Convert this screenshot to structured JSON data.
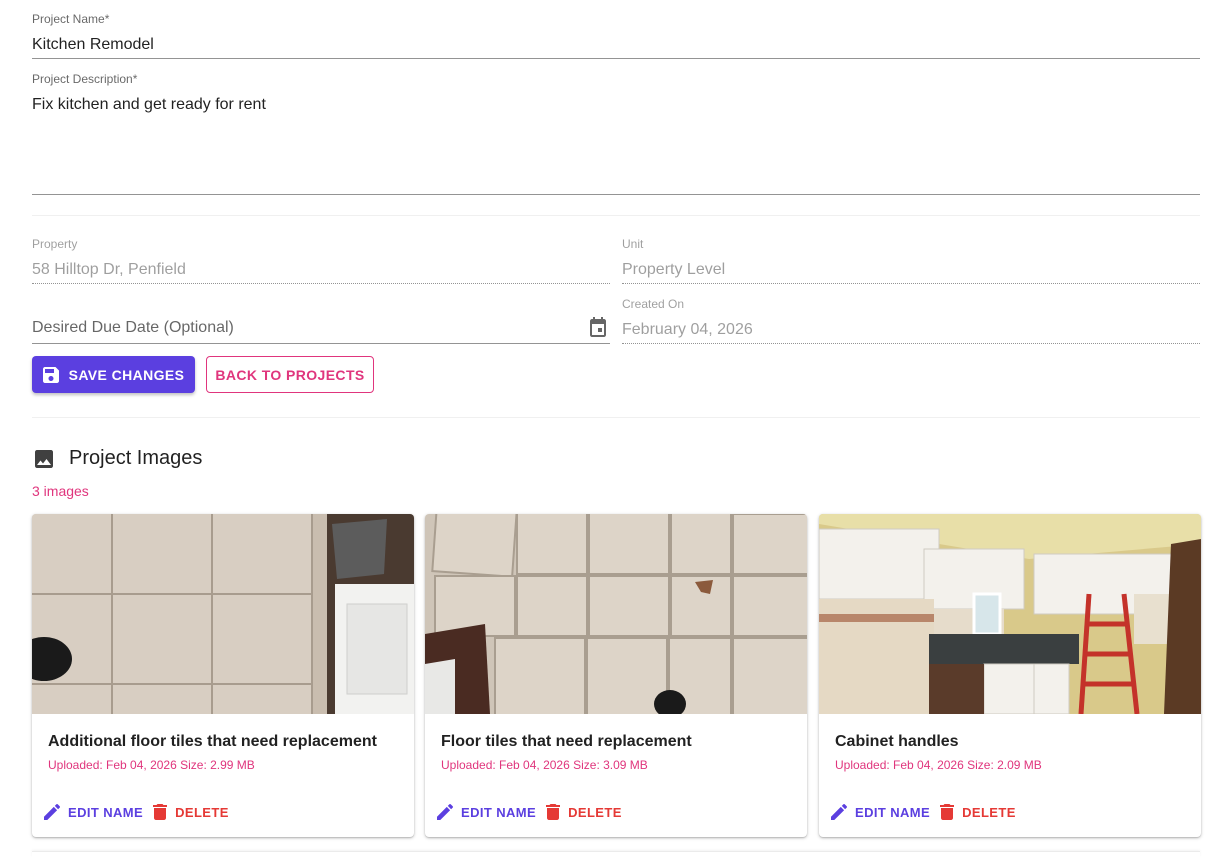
{
  "form": {
    "project_name": {
      "label": "Project Name*",
      "value": "Kitchen Remodel"
    },
    "project_description": {
      "label": "Project Description*",
      "value": "Fix kitchen and get ready for rent"
    },
    "property": {
      "label": "Property",
      "value": "58 Hilltop Dr, Penfield"
    },
    "unit": {
      "label": "Unit",
      "value": "Property Level"
    },
    "due_date": {
      "placeholder": "Desired Due Date (Optional)"
    },
    "created_on": {
      "label": "Created On",
      "value": "February 04, 2026"
    }
  },
  "actions": {
    "save_label": "SAVE CHANGES",
    "back_label": "BACK TO PROJECTS"
  },
  "images_section": {
    "title": "Project Images",
    "count": "3 images",
    "cards": [
      {
        "title": "Additional floor tiles that need replacement",
        "meta": "Uploaded: Feb 04, 2026 Size: 2.99 MB",
        "edit_label": "EDIT NAME",
        "delete_label": "DELETE"
      },
      {
        "title": "Floor tiles that need replacement",
        "meta": "Uploaded: Feb 04, 2026 Size: 3.09 MB",
        "edit_label": "EDIT NAME",
        "delete_label": "DELETE"
      },
      {
        "title": "Cabinet handles",
        "meta": "Uploaded: Feb 04, 2026 Size: 2.09 MB",
        "edit_label": "EDIT NAME",
        "delete_label": "DELETE"
      }
    ]
  },
  "colors": {
    "primary": "#5b3fe0",
    "accent": "#e0357d",
    "danger": "#e53935"
  }
}
